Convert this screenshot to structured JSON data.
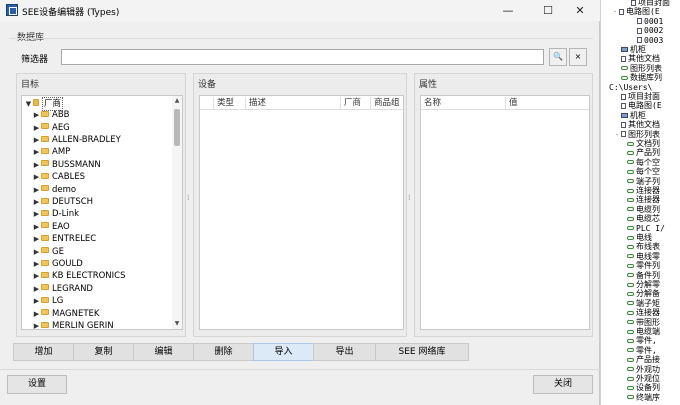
{
  "window": {
    "title": "SEE设备编辑器 (Types)",
    "minimize_glyph": "—",
    "maximize_glyph": "☐",
    "close_glyph": "✕"
  },
  "section_label": "数据库",
  "filter": {
    "label": "筛选器",
    "value": "",
    "placeholder": "",
    "search_glyph": "🔍",
    "clear_glyph": "×"
  },
  "target_panel": {
    "title": "目标",
    "root": "厂商",
    "items": [
      "ABB",
      "AEG",
      "ALLEN-BRADLEY",
      "AMP",
      "BUSSMANN",
      "CABLES",
      "demo",
      "DEUTSCH",
      "D-Link",
      "EAO",
      "ENTRELEC",
      "GE",
      "GOULD",
      "KB ELECTRONICS",
      "LEGRAND",
      "LG",
      "MAGNETEK",
      "MERLIN GERIN"
    ]
  },
  "device_panel": {
    "title": "设备",
    "columns": [
      "类型",
      "描述",
      "厂商",
      "商品组"
    ]
  },
  "property_panel": {
    "title": "属性",
    "columns": [
      "名称",
      "值"
    ]
  },
  "actions": [
    "增加",
    "复制",
    "编辑",
    "删除",
    "导入",
    "导出",
    "SEE 网络库"
  ],
  "footer": {
    "settings": "设置",
    "close": "关闭"
  },
  "background_tree": [
    {
      "exp": "",
      "icon": "doc",
      "text": "项目封面"
    },
    {
      "exp": "-",
      "icon": "doc",
      "text": "电路图(E"
    },
    {
      "exp": "",
      "icon": "doc",
      "text": "0001"
    },
    {
      "exp": "",
      "icon": "doc",
      "text": "0002"
    },
    {
      "exp": "",
      "icon": "doc",
      "text": "0003"
    },
    {
      "exp": "",
      "icon": "mon",
      "text": "机柜"
    },
    {
      "exp": "",
      "icon": "doc",
      "text": "其他文档"
    },
    {
      "exp": "",
      "icon": "chain",
      "text": "图形列表"
    },
    {
      "exp": "",
      "icon": "chain",
      "text": "数据库列"
    },
    {
      "exp": "",
      "icon": "",
      "text": "C:\\Users\\"
    },
    {
      "exp": "",
      "icon": "doc",
      "text": "项目封面"
    },
    {
      "exp": "",
      "icon": "doc",
      "text": "电路图(E"
    },
    {
      "exp": "",
      "icon": "mon",
      "text": "机柜"
    },
    {
      "exp": "",
      "icon": "doc",
      "text": "其他文档"
    },
    {
      "exp": "-",
      "icon": "doc",
      "text": "图形列表"
    },
    {
      "exp": "",
      "icon": "chain",
      "text": "文档列"
    },
    {
      "exp": "",
      "icon": "chain",
      "text": "产品列"
    },
    {
      "exp": "",
      "icon": "chain",
      "text": "每个空"
    },
    {
      "exp": "",
      "icon": "chain",
      "text": "每个空"
    },
    {
      "exp": "",
      "icon": "chain",
      "text": "端子列"
    },
    {
      "exp": "",
      "icon": "chain",
      "text": "连接器"
    },
    {
      "exp": "",
      "icon": "chain",
      "text": "连接器"
    },
    {
      "exp": "",
      "icon": "chain",
      "text": "电缆列"
    },
    {
      "exp": "",
      "icon": "chain",
      "text": "电缆芯"
    },
    {
      "exp": "",
      "icon": "chain",
      "text": "PLC I/"
    },
    {
      "exp": "",
      "icon": "chain",
      "text": "电线"
    },
    {
      "exp": "",
      "icon": "chain",
      "text": "布线表"
    },
    {
      "exp": "",
      "icon": "chain",
      "text": "电线零"
    },
    {
      "exp": "",
      "icon": "chain",
      "text": "零件列"
    },
    {
      "exp": "",
      "icon": "chain",
      "text": "备件列"
    },
    {
      "exp": "",
      "icon": "chain",
      "text": "分解零"
    },
    {
      "exp": "",
      "icon": "chain",
      "text": "分解备"
    },
    {
      "exp": "",
      "icon": "chain",
      "text": "端子矩"
    },
    {
      "exp": "",
      "icon": "chain",
      "text": "连接器"
    },
    {
      "exp": "",
      "icon": "chain",
      "text": "带图形"
    },
    {
      "exp": "",
      "icon": "chain",
      "text": "电缆端"
    },
    {
      "exp": "",
      "icon": "chain",
      "text": "零件,"
    },
    {
      "exp": "",
      "icon": "chain",
      "text": "零件,"
    },
    {
      "exp": "",
      "icon": "chain",
      "text": "产品接"
    },
    {
      "exp": "",
      "icon": "chain",
      "text": "外观功"
    },
    {
      "exp": "",
      "icon": "chain",
      "text": "外观位"
    },
    {
      "exp": "",
      "icon": "chain",
      "text": "设备列"
    },
    {
      "exp": "",
      "icon": "chain",
      "text": "终端序"
    }
  ]
}
